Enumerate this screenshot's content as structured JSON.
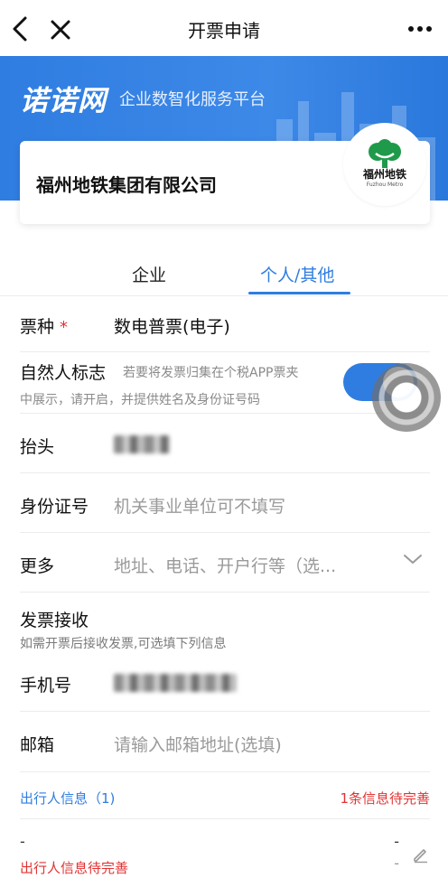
{
  "nav": {
    "title": "开票申请"
  },
  "banner": {
    "brand": "诺诺网",
    "slogan": "企业数智化服务平台"
  },
  "company": {
    "name": "福州地铁集团有限公司",
    "logo_cn": "福州地铁",
    "logo_en": "Fuzhou Metro"
  },
  "tabs": [
    {
      "label": "企业"
    },
    {
      "label": "个人/其他"
    }
  ],
  "form": {
    "ticket_type": {
      "label": "票种",
      "required_mark": "*",
      "value": "数电普票(电子)"
    },
    "natural_person": {
      "label": "自然人标志",
      "hint_line1": "若要将发票归集在个税APP票夹",
      "hint_line2": "中展示，请开启，并提供姓名及身份证号码",
      "enabled": true
    },
    "header_title": {
      "label": "抬头"
    },
    "id_number": {
      "label": "身份证号",
      "placeholder": "机关事业单位可不填写"
    },
    "more": {
      "label": "更多",
      "placeholder": "地址、电话、开户行等（选..."
    },
    "receive": {
      "title": "发票接收",
      "hint": "如需开票后接收发票,可选填下列信息"
    },
    "phone": {
      "label": "手机号"
    },
    "email": {
      "label": "邮箱",
      "placeholder": "请输入邮箱地址(选填)"
    }
  },
  "traveler": {
    "title": "出行人信息（1)",
    "status": "1条信息待完善",
    "item_dash": "-",
    "item_dash_right1": "-",
    "item_dash_right2": "-",
    "item_pending": "出行人信息待完善"
  },
  "colors": {
    "accent": "#2f7de1",
    "danger": "#e23333"
  }
}
